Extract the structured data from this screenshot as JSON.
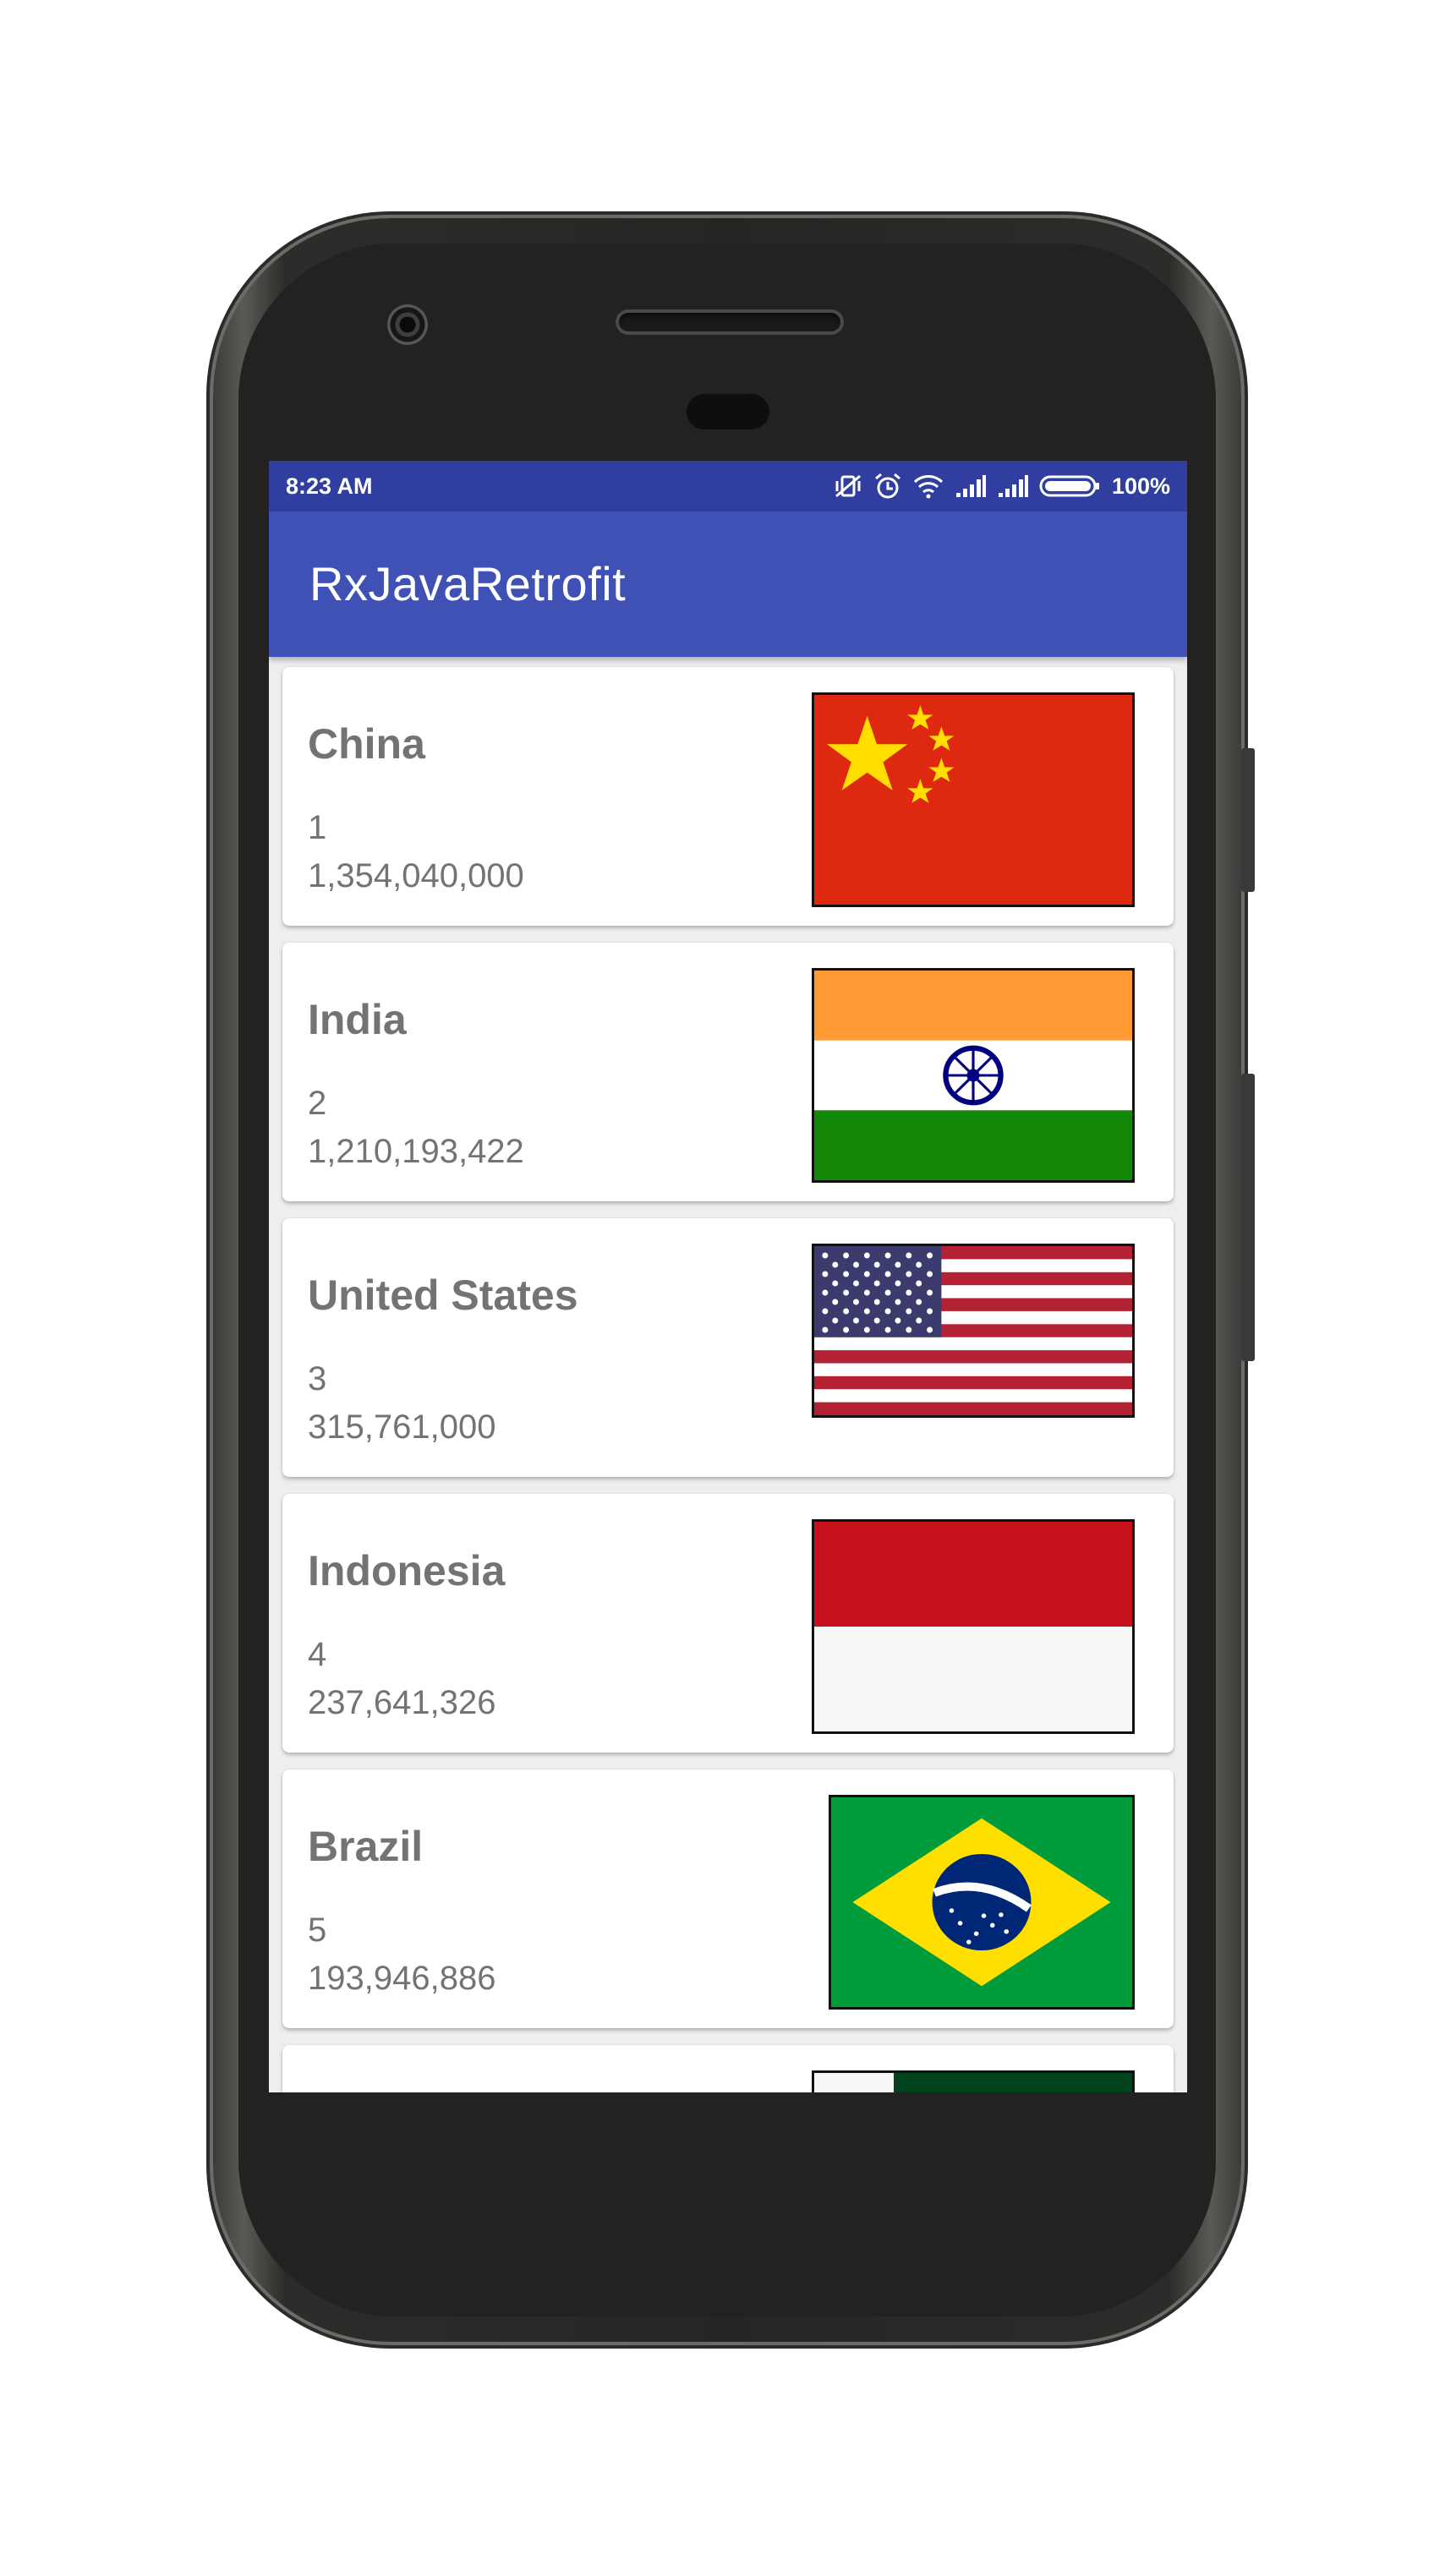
{
  "status_bar": {
    "time": "8:23 AM",
    "battery": "100%",
    "icons": [
      "vibrate-off-icon",
      "alarm-icon",
      "wifi-icon",
      "signal-icon",
      "signal-icon",
      "battery-icon"
    ]
  },
  "app_bar": {
    "title": "RxJavaRetrofit"
  },
  "countries": [
    {
      "name": "China",
      "rank": "1",
      "population": "1,354,040,000",
      "flag": "china-flag"
    },
    {
      "name": "India",
      "rank": "2",
      "population": "1,210,193,422",
      "flag": "india-flag"
    },
    {
      "name": "United States",
      "rank": "3",
      "population": "315,761,000",
      "flag": "usa-flag"
    },
    {
      "name": "Indonesia",
      "rank": "4",
      "population": "237,641,326",
      "flag": "indonesia-flag"
    },
    {
      "name": "Brazil",
      "rank": "5",
      "population": "193,946,886",
      "flag": "brazil-flag"
    },
    {
      "name": "",
      "rank": "",
      "population": "",
      "flag": "pakistan-flag"
    }
  ],
  "colors": {
    "status_bar": "#303f9f",
    "app_bar": "#3f51b5",
    "card_text": "#737373"
  }
}
